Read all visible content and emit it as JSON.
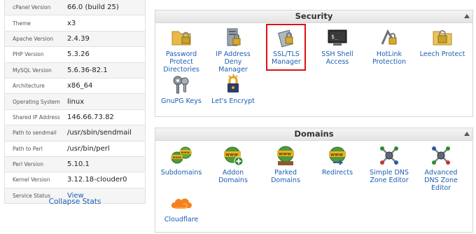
{
  "stats": [
    {
      "label": "cPanel Version",
      "value": "66.0 (build 25)"
    },
    {
      "label": "Theme",
      "value": "x3"
    },
    {
      "label": "Apache Version",
      "value": "2.4.39"
    },
    {
      "label": "PHP Version",
      "value": "5.3.26"
    },
    {
      "label": "MySQL Version",
      "value": "5.6.36-82.1"
    },
    {
      "label": "Architecture",
      "value": "x86_64"
    },
    {
      "label": "Operating System",
      "value": "linux"
    },
    {
      "label": "Shared IP Address",
      "value": "146.66.73.82"
    },
    {
      "label": "Path to sendmail",
      "value": "/usr/sbin/sendmail"
    },
    {
      "label": "Path to Perl",
      "value": "/usr/bin/perl"
    },
    {
      "label": "Perl Version",
      "value": "5.10.1"
    },
    {
      "label": "Kernel Version",
      "value": "3.12.18-clouder0"
    },
    {
      "label": "Service Status",
      "value": "View"
    }
  ],
  "collapse_label": "Collapse Stats",
  "security": {
    "title": "Security",
    "items": [
      {
        "l1": "Password",
        "l2": "Protect",
        "l3": "Directories",
        "icon": "folder-lock-icon"
      },
      {
        "l1": "IP Address",
        "l2": "Deny",
        "l3": "Manager",
        "icon": "server-lock-icon"
      },
      {
        "l1": "SSL/TLS",
        "l2": "Manager",
        "l3": "",
        "icon": "ssl-certificate-icon"
      },
      {
        "l1": "SSH Shell",
        "l2": "Access",
        "l3": "",
        "icon": "terminal-icon"
      },
      {
        "l1": "HotLink",
        "l2": "Protection",
        "l3": "",
        "icon": "hotlink-lock-icon"
      },
      {
        "l1": "Leech Protect",
        "l2": "",
        "l3": "",
        "icon": "folder-lock-icon"
      },
      {
        "l1": "GnuPG Keys",
        "l2": "",
        "l3": "",
        "icon": "keys-icon"
      },
      {
        "l1": "Let's Encrypt",
        "l2": "",
        "l3": "",
        "icon": "padlock-icon"
      }
    ]
  },
  "domains": {
    "title": "Domains",
    "items": [
      {
        "l1": "Subdomains",
        "l2": "",
        "l3": "",
        "icon": "www-globes-icon"
      },
      {
        "l1": "Addon",
        "l2": "Domains",
        "l3": "",
        "icon": "www-add-icon"
      },
      {
        "l1": "Parked",
        "l2": "Domains",
        "l3": "",
        "icon": "www-parked-icon"
      },
      {
        "l1": "Redirects",
        "l2": "",
        "l3": "",
        "icon": "www-redirect-icon"
      },
      {
        "l1": "Simple DNS",
        "l2": "Zone Editor",
        "l3": "",
        "icon": "dns-network-icon"
      },
      {
        "l1": "Advanced",
        "l2": "DNS Zone",
        "l3": "Editor",
        "icon": "dns-network-icon"
      },
      {
        "l1": "Cloudflare",
        "l2": "",
        "l3": "",
        "icon": "cloudflare-icon"
      }
    ]
  },
  "colors": {
    "link": "#1a5fb4",
    "highlight": "#e01010"
  }
}
